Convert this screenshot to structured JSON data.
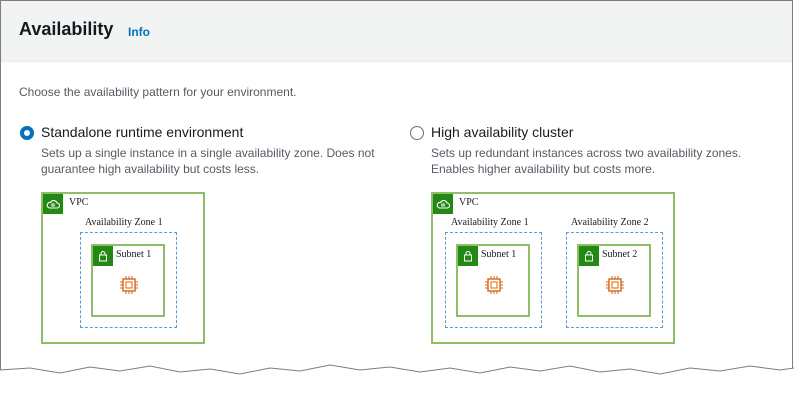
{
  "header": {
    "title": "Availability",
    "info_label": "Info"
  },
  "description": "Choose the availability pattern for your environment.",
  "options": [
    {
      "label": "Standalone runtime environment",
      "selected": true,
      "description_line1": "Sets up a single instance in a single availability zone. Does not",
      "description_line2": "guarantee high availability but costs less.",
      "diagram": {
        "vpc": "VPC",
        "zones": [
          {
            "zone": "Availability Zone 1",
            "subnet": "Subnet 1"
          }
        ]
      }
    },
    {
      "label": "High availability cluster",
      "selected": false,
      "description_line1": "Sets up redundant instances across two availability zones.",
      "description_line2": "Enables higher availability but costs more.",
      "diagram": {
        "vpc": "VPC",
        "zones": [
          {
            "zone": "Availability Zone 1",
            "subnet": "Subnet 1"
          },
          {
            "zone": "Availability Zone 2",
            "subnet": "Subnet 2"
          }
        ]
      }
    }
  ],
  "colors": {
    "accent": "#0073bb",
    "vpc_green": "#248814",
    "zone_blue": "#5b9bd5",
    "chip_orange": "#d86613"
  }
}
